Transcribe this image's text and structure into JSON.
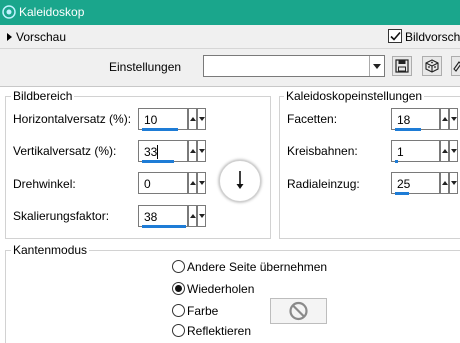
{
  "window": {
    "title": "Kaleidoskop",
    "icon": "app-icon"
  },
  "preview": {
    "label": "Vorschau",
    "bildvorschau_label": "Bildvorscha",
    "bildvorschau_checked": true
  },
  "settings": {
    "label": "Einstellungen",
    "value": "",
    "buttons": [
      "save-icon",
      "random-dice-icon",
      "reset-eraser-icon"
    ]
  },
  "bildbereich": {
    "title": "Bildbereich",
    "fields": [
      {
        "label": "Horizontalversatz (%):",
        "value": "10",
        "fill": 0.85
      },
      {
        "label": "Vertikalversatz (%):",
        "value": "33",
        "fill": 0.75
      },
      {
        "label": "Drehwinkel:",
        "value": "0",
        "fill": 0
      },
      {
        "label": "Skalierungsfaktor:",
        "value": "38",
        "fill": 1.0
      }
    ],
    "dial_icon": "rotation-dial-icon"
  },
  "kaleido": {
    "title": "Kaleidoskopeinstellungen",
    "fields": [
      {
        "label": "Facetten:",
        "value": "18",
        "fill": 0.6
      },
      {
        "label": "Kreisbahnen:",
        "value": "1",
        "fill": 0.05
      },
      {
        "label": "Radialeinzug:",
        "value": "25",
        "fill": 0.25
      }
    ]
  },
  "kantenmodus": {
    "title": "Kantenmodus",
    "options": [
      {
        "label": "Andere Seite übernehmen",
        "selected": false
      },
      {
        "label": "Wiederholen",
        "selected": true
      },
      {
        "label": "Farbe",
        "selected": false
      },
      {
        "label": "Reflektieren",
        "selected": false
      }
    ],
    "color_swatch_icon": "no-color-icon"
  },
  "colors": {
    "titlebar": "#1aa68c",
    "accent_bar": "#1e7cd6"
  }
}
